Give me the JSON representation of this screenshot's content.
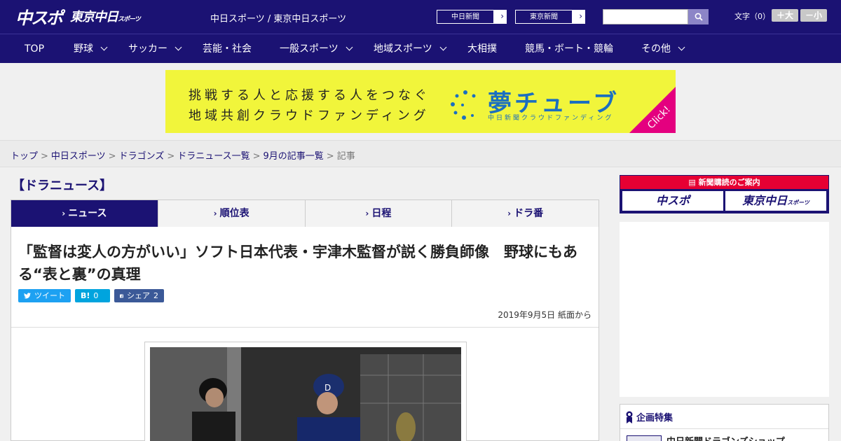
{
  "header": {
    "logo_chuspo": "中スポ",
    "logo_tokyo": "東京中日",
    "logo_tokyo_small": "スポーツ",
    "site_links": "中日スポーツ / 東京中日スポーツ",
    "chunichi_link": "中日新聞",
    "tokyo_link": "東京新聞",
    "search_placeholder": "",
    "font_label": "文字（0）",
    "font_up": "＋大",
    "font_down": "－小"
  },
  "nav": {
    "items": [
      {
        "label": "TOP"
      },
      {
        "label": "野球"
      },
      {
        "label": "サッカー"
      },
      {
        "label": "芸能・社会"
      },
      {
        "label": "一般スポーツ"
      },
      {
        "label": "地域スポーツ"
      },
      {
        "label": "大相撲"
      },
      {
        "label": "競馬・ボート・競輪"
      },
      {
        "label": "その他"
      }
    ]
  },
  "banner": {
    "line1": "挑戦する人と応援する人をつなぐ",
    "line2": "地域共創クラウドファンディング",
    "brand": "夢チューブ",
    "brand_sub": "中日新聞クラウドファンディング",
    "click": "Click!",
    "colors": {
      "bg": "#f1f53b",
      "brand": "#1b6fc0",
      "click": "#e4007f"
    }
  },
  "breadcrumb": {
    "items": [
      "トップ",
      "中日スポーツ",
      "ドラゴンズ",
      "ドラニュース一覧",
      "9月の記事一覧"
    ],
    "current": "記事",
    "separator": ">"
  },
  "main": {
    "section_title": "【ドラニュース】",
    "tabs": [
      {
        "label": "ニュース",
        "active": true
      },
      {
        "label": "順位表",
        "active": false
      },
      {
        "label": "日程",
        "active": false
      },
      {
        "label": "ドラ番",
        "active": false
      }
    ],
    "headline": "「監督は変人の方がいい」ソフト日本代表・宇津木監督が説く勝負師像　野球にもある“表と裏”の真理",
    "social": {
      "tweet": "ツイート",
      "hatena_label": "B!",
      "hatena_count": "0",
      "share": "シェア",
      "share_count": "2"
    },
    "date": "2019年9月5日 紙面から"
  },
  "sidebar": {
    "subscribe_title": "新聞購読のご案内",
    "sub_logo1": "中スポ",
    "sub_logo2": "東京中日",
    "sub_logo2_small": "スポーツ",
    "feature_title": "企画特集",
    "feature_item": "中日新聞ドラゴンズショップ"
  },
  "colors": {
    "brand_navy": "#1b1273",
    "accent_red": "#e60033"
  }
}
